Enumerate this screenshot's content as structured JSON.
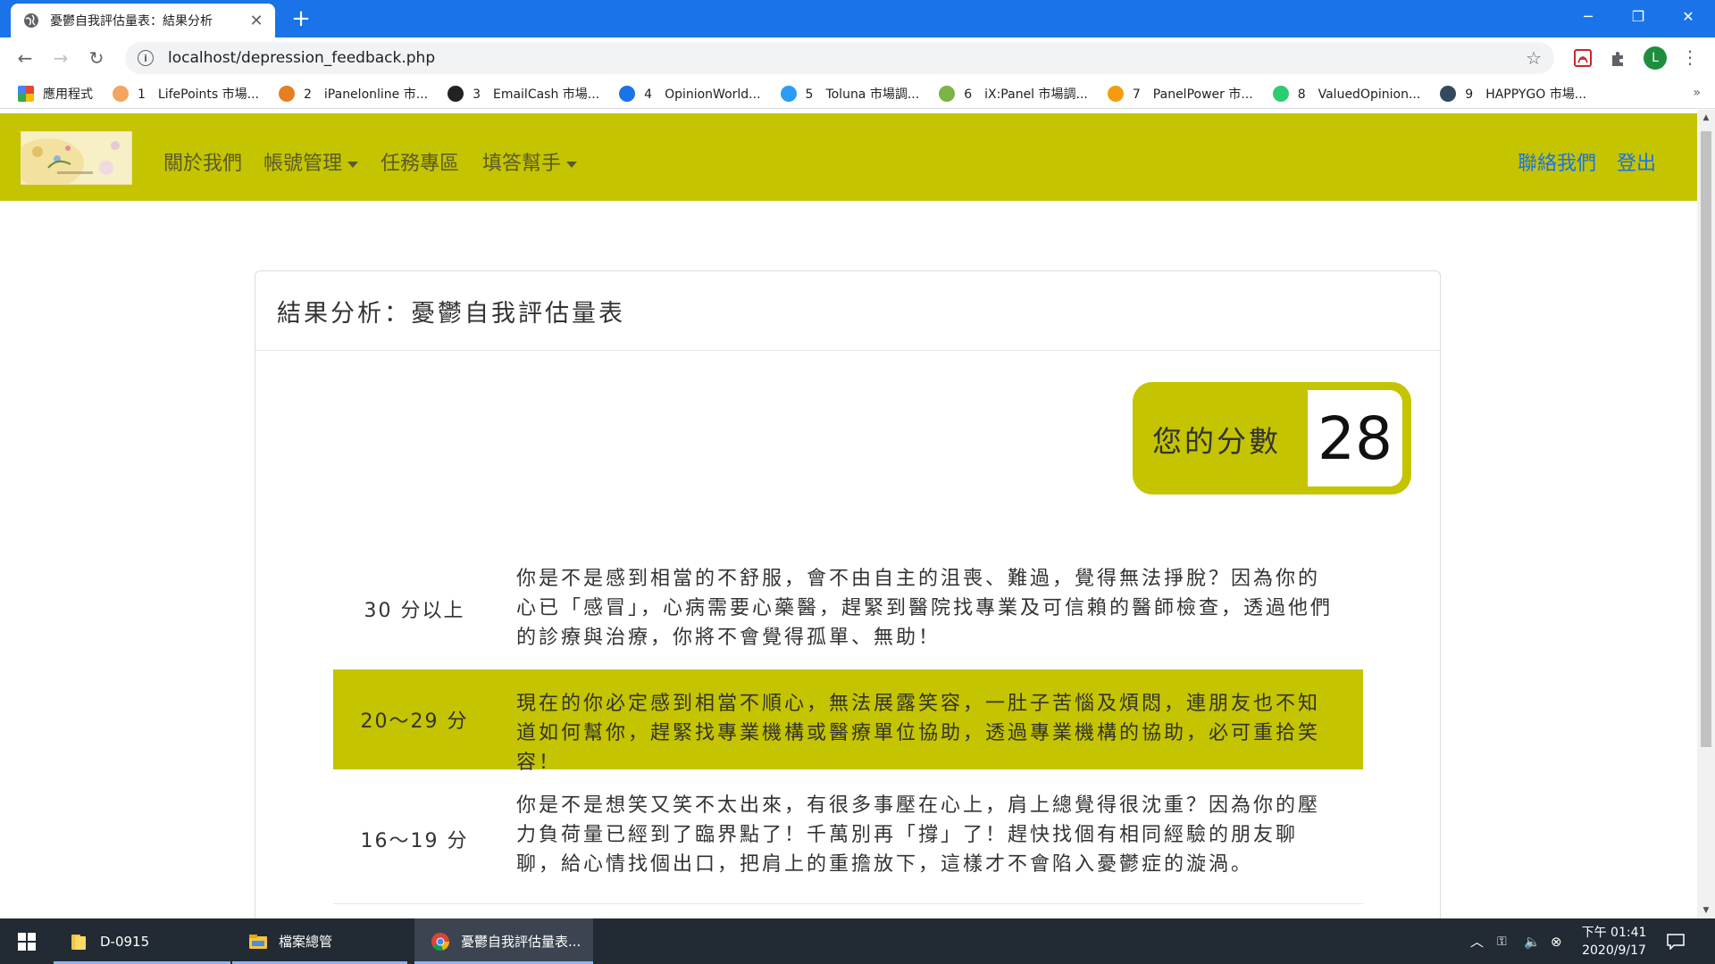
{
  "browser": {
    "tab_title": "憂鬱自我評估量表：結果分析",
    "url": "localhost/depression_feedback.php",
    "profile_initial": "L",
    "bookmarks": [
      {
        "label": "應用程式",
        "icon": "apps-grid-icon",
        "color": "#ea4335"
      },
      {
        "label": "1　LifePoints 市場...",
        "icon": "lifepoints-icon",
        "color": "#f4a460"
      },
      {
        "label": "2　iPanelonline 市...",
        "icon": "ipanel-icon",
        "color": "#e67e22"
      },
      {
        "label": "3　EmailCash 市場...",
        "icon": "emailcash-icon",
        "color": "#222222"
      },
      {
        "label": "4　OpinionWorld...",
        "icon": "opinionworld-icon",
        "color": "#1a73e8"
      },
      {
        "label": "5　Toluna 市場調...",
        "icon": "toluna-icon",
        "color": "#2a9df4"
      },
      {
        "label": "6　iX:Panel 市場調...",
        "icon": "ixpanel-icon",
        "color": "#7cb342"
      },
      {
        "label": "7　PanelPower 市...",
        "icon": "panelpower-icon",
        "color": "#f39c12"
      },
      {
        "label": "8　ValuedOpinion...",
        "icon": "valuedopinion-icon",
        "color": "#2ecc71"
      },
      {
        "label": "9　HAPPYGO 市場...",
        "icon": "happygo-icon",
        "color": "#34495e"
      }
    ],
    "bookmarks_more": "»"
  },
  "site": {
    "nav": {
      "about": "關於我們",
      "account": "帳號管理",
      "tasks": "任務專區",
      "helper": "填答幫手",
      "contact": "聯絡我們",
      "logout": "登出"
    },
    "colors": {
      "accent": "#c4c400",
      "link": "#1a73e8"
    }
  },
  "result": {
    "title": "結果分析：憂鬱自我評估量表",
    "score_label": "您的分數",
    "score": "28",
    "rows": [
      {
        "range": "30 分以上",
        "desc": "你是不是感到相當的不舒服，會不由自主的沮喪、難過，覺得無法掙脫？因為你的心已「感冒」，心病需要心藥醫，趕緊到醫院找專業及可信賴的醫師檢查，透過他們的診療與治療，你將不會覺得孤單、無助！",
        "highlighted": false
      },
      {
        "range": "20～29 分",
        "desc": "現在的你必定感到相當不順心，無法展露笑容，一肚子苦惱及煩悶，連朋友也不知道如何幫你，趕緊找專業機構或醫療單位協助，透過專業機構的協助，必可重拾笑容！",
        "highlighted": true
      },
      {
        "range": "16～19 分",
        "desc": "你是不是想笑又笑不太出來，有很多事壓在心上，肩上總覺得很沈重？因為你的壓力負荷量已經到了臨界點了！千萬別再「撐」了！趕快找個有相同經驗的朋友聊聊，給心情找個出口，把肩上的重擔放下，這樣才不會陷入憂鬱症的漩渦。",
        "highlighted": false
      }
    ]
  },
  "taskbar": {
    "items": [
      {
        "label": "D-0915",
        "icon": "folder-icon"
      },
      {
        "label": "檔案總管",
        "icon": "file-explorer-icon"
      },
      {
        "label": "憂鬱自我評估量表...",
        "icon": "chrome-icon"
      }
    ],
    "clock_period_time": "下午 01:41",
    "clock_date": "2020/9/17"
  }
}
